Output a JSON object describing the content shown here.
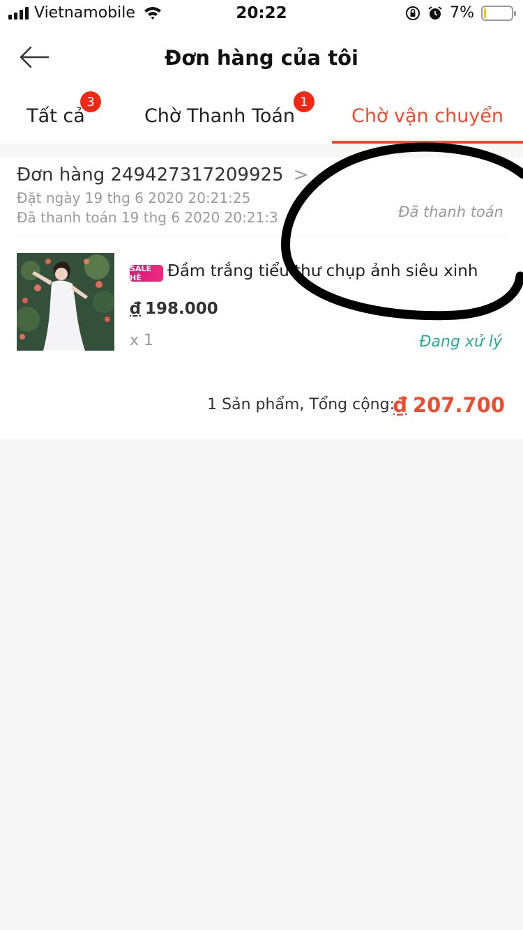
{
  "status_bar": {
    "carrier": "Vietnamobile",
    "time": "20:22",
    "battery_percent": "7%",
    "battery_level": 0.07,
    "battery_color": "#f5c400"
  },
  "header": {
    "title": "Đơn hàng của tôi",
    "back_icon": "arrow-left-icon"
  },
  "tabs": [
    {
      "label": "Tất cả",
      "badge": "3",
      "active": false
    },
    {
      "label": "Chờ Thanh Toán",
      "badge": "1",
      "active": false
    },
    {
      "label": "Chờ vận chuyển",
      "badge": "",
      "active": true
    }
  ],
  "order": {
    "order_label": "Đơn hàng 249427317209925",
    "arrow": ">",
    "placed_on": "Đặt ngày 19 thg 6 2020  20:21:25",
    "paid_on": "Đã thanh toán 19 thg 6 2020  20:21:3",
    "payment_status": "Đã thanh toán",
    "product": {
      "tag": "SALE HÈ",
      "name": "Đầm trắng tiểu thư chụp ảnh siêu xinh",
      "currency": "₫",
      "price": "198.000",
      "quantity": "x 1",
      "status": "Đang xử lý"
    },
    "summary": {
      "label": "1 Sản phẩm, Tổng cộng:",
      "currency": "₫",
      "total": "207.700"
    }
  },
  "colors": {
    "accent": "#ee4d2d",
    "badge": "#ee2a14",
    "status_teal": "#26aa99",
    "annotation": "#000000"
  }
}
